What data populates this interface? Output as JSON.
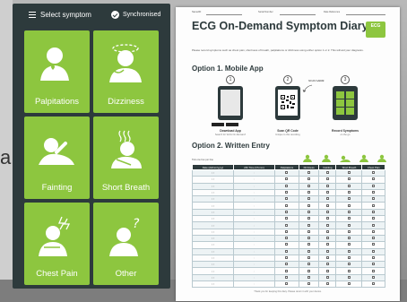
{
  "app": {
    "menu_icon": "hamburger-menu-icon",
    "title": "Select symptom",
    "sync_icon": "check-circle-icon",
    "sync_status": "Synchronised"
  },
  "symptoms": [
    {
      "label": "Palpitations",
      "icon": "palpitations-person-icon"
    },
    {
      "label": "Dizziness",
      "icon": "dizziness-person-icon"
    },
    {
      "label": "Fainting",
      "icon": "fainting-person-icon"
    },
    {
      "label": "Short Breath",
      "icon": "short-breath-person-icon"
    },
    {
      "label": "Chest Pain",
      "icon": "chest-pain-person-icon"
    },
    {
      "label": "Other",
      "icon": "other-question-person-icon"
    }
  ],
  "document": {
    "meta": {
      "name": "Name/ID",
      "serial": "Serial Number",
      "date_ref": "Date Reference"
    },
    "title": "ECG On-Demand Symptom Diary",
    "logo": "ECG",
    "intro": "Please record symptoms such as chest pain, shortness of breath, palpitations or dizziness using either option 1 or 2. This will aid your diagnosis.",
    "option1": {
      "title": "Option 1. Mobile App",
      "steps": [
        {
          "num": "1",
          "caption": "Download App",
          "sub": "Search for 'ECG On-Demand'"
        },
        {
          "num": "2",
          "caption": "Scan QR Code",
          "sub": "Unique to this recording"
        },
        {
          "num": "3",
          "caption": "Record Symptoms",
          "sub": "on the go"
        }
      ],
      "scan_label": "SCAN HERE",
      "qr_code": "qr-code"
    },
    "option2": {
      "title": "Option 2. Written Entry",
      "tick_note": "Tick one box per line",
      "columns": [
        "Date (dd/mm/yyyy)",
        "24h Time (hh:mm)",
        "Palpitations",
        "Dizziness",
        "Fainting",
        "Short Breath",
        "Chest Pain"
      ],
      "row_count": 18,
      "date_placeholder": "/  /",
      "time_placeholder": ":"
    },
    "footer": "Thank you for keeping this diary. Please return it with your device."
  },
  "colors": {
    "tile_green": "#8dc63f",
    "phone_dark": "#2d3a3c",
    "doc_header": "#2d3a3c"
  }
}
